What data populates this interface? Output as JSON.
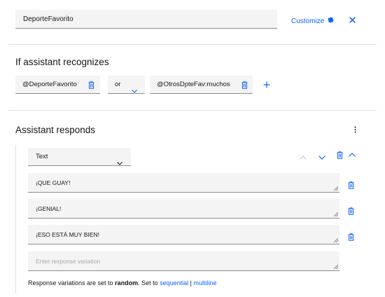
{
  "node": {
    "name": "DeporteFavorito",
    "customize_label": "Customize",
    "customize_icon": "gear-icon",
    "close_icon": "close-icon"
  },
  "condition": {
    "title": "If assistant recognizes",
    "entity_1": "@DeporteFavorito",
    "operator": "or",
    "entity_2": "@OtrosDpteFav:muchos",
    "add_icon": "plus-icon"
  },
  "responses": {
    "title": "Assistant responds",
    "type": "Text",
    "variations": [
      "¡QUE GUAY!",
      "¡GENIAL!",
      "¡ESO ESTÁ MUY BIEN!"
    ],
    "new_placeholder": "Enter response variation",
    "footer_prefix": "Response variations are set to ",
    "footer_mode": "random",
    "footer_mid": ". Set to ",
    "footer_link_sequential": "sequential",
    "footer_sep": " | ",
    "footer_link_multiline": "multiline"
  },
  "colors": {
    "accent": "#0f62fe",
    "field_bg": "#f4f4f4"
  }
}
